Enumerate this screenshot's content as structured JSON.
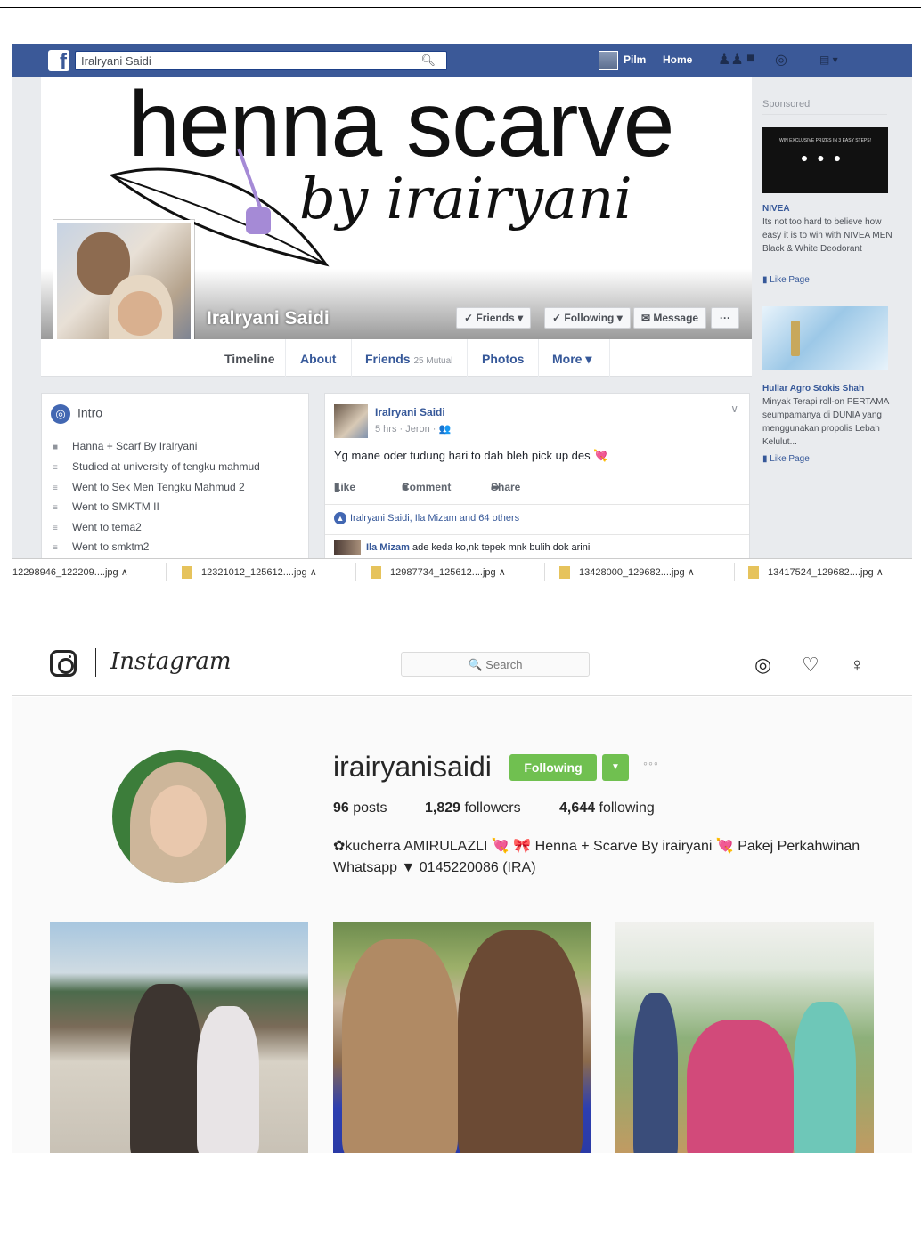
{
  "facebook": {
    "search_value": "Iralryani Saidi",
    "nav": {
      "user": "Pilm",
      "home": "Home"
    },
    "cover": {
      "title": "henna scarve",
      "script": "by irairyani"
    },
    "profile_name": "Iralryani Saidi",
    "buttons": {
      "friends": "✓ Friends ▾",
      "following": "✓ Following ▾",
      "message": "✉ Message",
      "more": "···"
    },
    "tabs": {
      "timeline": "Timeline",
      "about": "About",
      "friends": "Friends",
      "friends_count": "25 Mutual",
      "photos": "Photos",
      "more": "More ▾"
    },
    "intro": {
      "title": "Intro",
      "items": [
        "Hanna + Scarf By Iralryani",
        "Studied at university of tengku mahmud",
        "Went to Sek Men Tengku Mahmud 2",
        "Went to SMKTM II",
        "Went to tema2",
        "Went to smktm2"
      ]
    },
    "post": {
      "author": "Iralryani Saidi",
      "meta": "5 hrs · Jeron · 👥",
      "text": "Yg mane oder tudung hari to dah bleh pick up des 💘",
      "like": "Like",
      "comment": "Comment",
      "share": "Share",
      "likes_summary": "Iralryani Saidi, Ila Mizam and 64 others",
      "comment_author": "Ila Mizam",
      "comment_text": "ade keda ko,nk tepek mnk bulih dok arini"
    },
    "sponsored": {
      "heading": "Sponsored",
      "ad1": {
        "image_text": "WIN EXCLUSIVE PRIZES IN 3 EASY STEPS!",
        "brand": "NIVEA",
        "text": "Its not too hard to believe how easy it is to win with NIVEA MEN Black & White Deodorant",
        "like": "Like Page"
      },
      "ad2": {
        "brand": "Hullar Agro Stokis Shah",
        "text": "Minyak Terapi roll-on PERTAMA seumpamanya di DUNIA yang menggunakan propolis Lebah Kelulut...",
        "like": "Like Page"
      }
    },
    "downloads": [
      "12298946_122209....jpg",
      "12321012_125612....jpg",
      "12987734_125612....jpg",
      "13428000_129682....jpg",
      "13417524_129682....jpg"
    ]
  },
  "instagram": {
    "wordmark": "Instagram",
    "search_placeholder": "🔍 Search",
    "username": "irairyanisaidi",
    "follow_button": "Following",
    "stats": {
      "posts": "96",
      "posts_label": "posts",
      "followers": "1,829",
      "followers_label": "followers",
      "following": "4,644",
      "following_label": "following"
    },
    "bio_line1": "✿kucherra AMIRULAZLI 💘 🎀 Henna + Scarve By irairyani 💘 Pakej Perkahwinan",
    "bio_line2": "Whatsapp ▼ 0145220086 (IRA)"
  }
}
